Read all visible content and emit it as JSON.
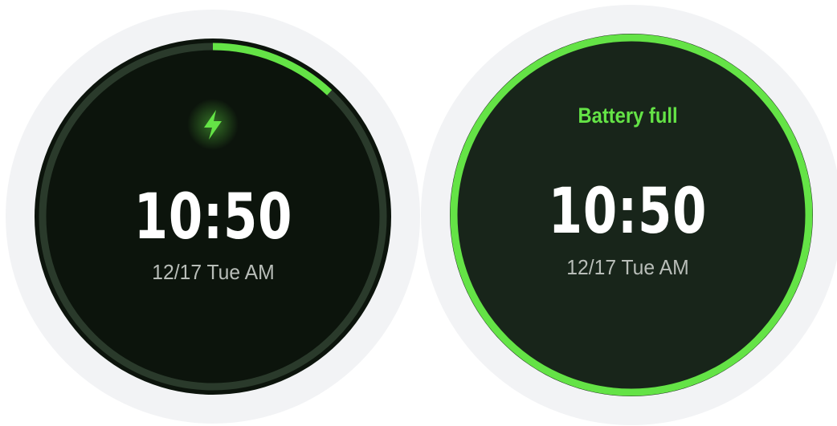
{
  "left_watch": {
    "time": "10:50",
    "date": "12/17 Tue AM",
    "charging_icon": "lightning-bolt-icon",
    "charge_level": 0.12
  },
  "right_watch": {
    "status": "Battery full",
    "time": "10:50",
    "date": "12/17 Tue AM",
    "charge_level": 1.0
  },
  "colors": {
    "accent_green": "#64e346",
    "face_dark": "#0c140c",
    "face_full": "#18251a",
    "track": "#2a3a2b",
    "bezel": "#f2f3f5"
  }
}
